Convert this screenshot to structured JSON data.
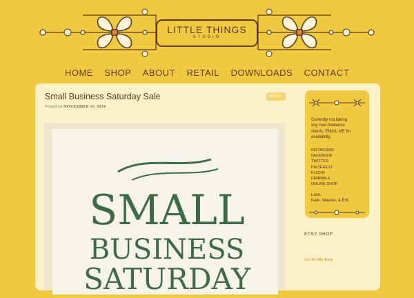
{
  "logo": {
    "title": "LITTLE THINGS",
    "subtitle": "STUDIO"
  },
  "nav": [
    "HOME",
    "SHOP",
    "ABOUT",
    "RETAIL",
    "DOWNLOADS",
    "CONTACT"
  ],
  "post": {
    "title": "Small Business Saturday Sale",
    "meta_prefix": "Posted on",
    "date": "NOVEMBER 19, 2014",
    "reply_label": "REPLY",
    "image_text": [
      "SMALL",
      "BUSINESS",
      "SATURDAY"
    ]
  },
  "sidebar": {
    "intro": [
      "Currently not taking",
      "any new freelance",
      "clients. EMAIL ME for",
      "availability."
    ],
    "links": [
      "INSTAGRAM",
      "FACEBOOK",
      "TWITTER",
      "PINTEREST",
      "FLICKR",
      "DRIBBBLE",
      "ONLINE SHOP"
    ],
    "signoff": [
      "Love,",
      "Kate, Weezie, & Eric"
    ],
    "etsy_title": "ETSY SHOP",
    "etsy_link": "Go To My Etsy"
  },
  "colors": {
    "background": "#f1c93e",
    "content": "#faf1c9",
    "ink": "#5a3a25",
    "lettering": "#3c6b46"
  }
}
